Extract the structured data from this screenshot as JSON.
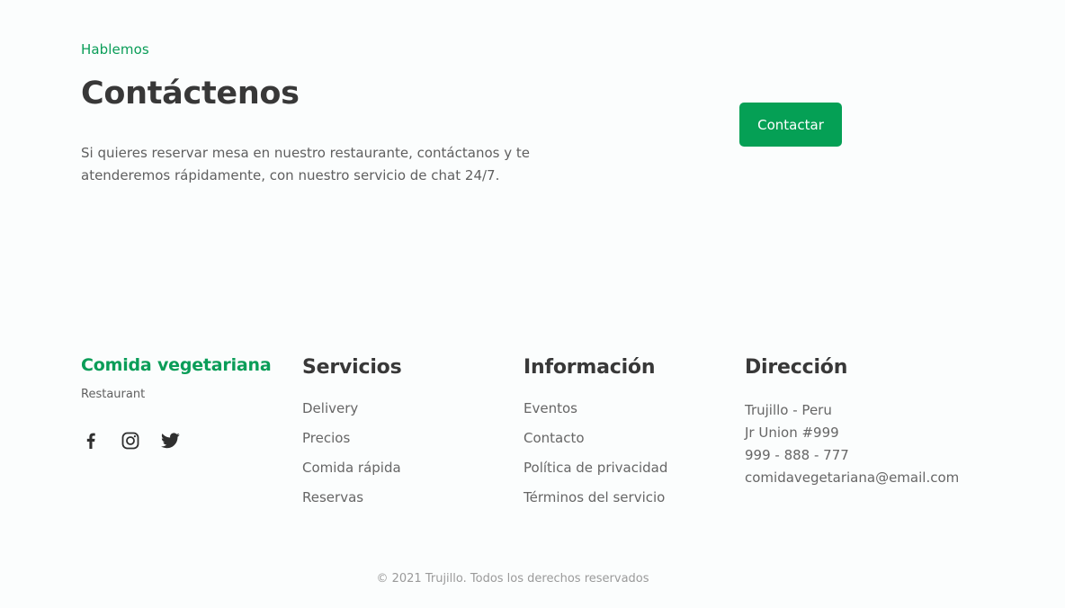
{
  "contact": {
    "eyebrow": "Hablemos",
    "title": "Contáctenos",
    "description": "Si quieres reservar mesa en nuestro restaurante, contáctanos y te atenderemos rápidamente, con nuestro servicio de chat 24/7.",
    "button_label": "Contactar"
  },
  "footer": {
    "brand": {
      "name": "Comida vegetariana",
      "subtitle": "Restaurant",
      "socials": [
        "facebook-icon",
        "instagram-icon",
        "twitter-icon"
      ]
    },
    "services": {
      "title": "Servicios",
      "items": [
        "Delivery",
        "Precios",
        "Comida rápida",
        "Reservas"
      ]
    },
    "information": {
      "title": "Información",
      "items": [
        "Eventos",
        "Contacto",
        "Política de privacidad",
        "Términos del servicio"
      ]
    },
    "address": {
      "title": "Dirección",
      "lines": [
        "Trujillo - Peru",
        "Jr Union #999",
        "999 - 888 - 777",
        "comidavegetariana@email.com"
      ]
    },
    "copyright": "© 2021 Trujillo. Todos los derechos reservados"
  },
  "colors": {
    "accent": "#05a055",
    "background": "#fbfdfd",
    "heading": "#383838",
    "body_text": "#5f5f5f"
  }
}
